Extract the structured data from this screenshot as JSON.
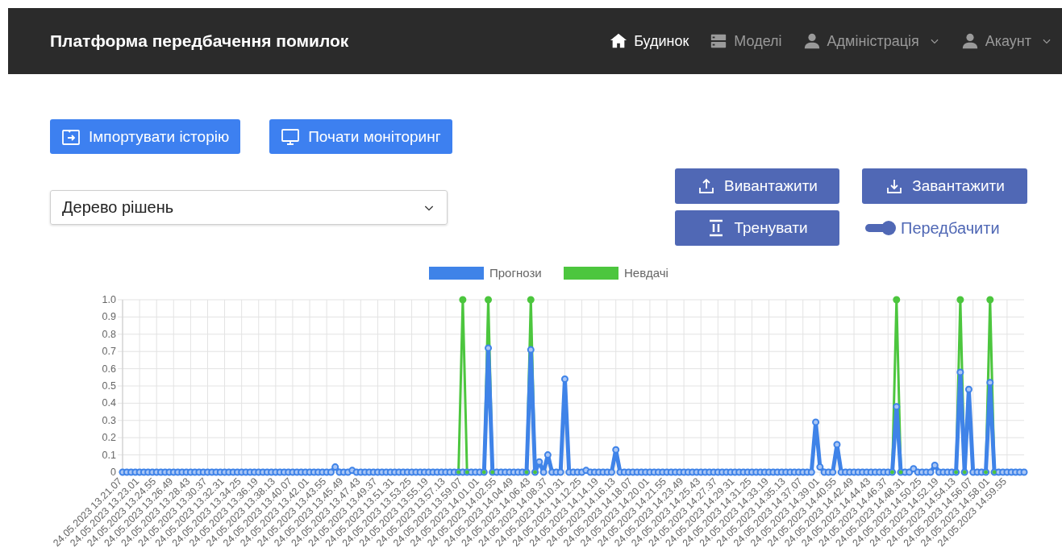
{
  "navbar": {
    "title": "Платформа передбачення помилок",
    "items": [
      {
        "label": "Будинок",
        "selected": true,
        "kind": "link"
      },
      {
        "label": "Моделі",
        "selected": false,
        "kind": "link"
      },
      {
        "label": "Адміністрація",
        "selected": false,
        "kind": "dropdown"
      },
      {
        "label": "Акаунт",
        "selected": false,
        "kind": "dropdown"
      }
    ]
  },
  "actions": [
    {
      "label": "Імпортувати історію"
    },
    {
      "label": "Почати моніторинг"
    }
  ],
  "model_select": {
    "value": "Дерево рішень"
  },
  "model_actions": [
    {
      "label": "Вивантажити"
    },
    {
      "label": "Завантажити"
    },
    {
      "label": "Тренувати"
    }
  ],
  "predict_toggle": {
    "label": "Передбачити",
    "on": true
  },
  "chart": {
    "chart_data": {
      "type": "line",
      "categories": [
        "24.05.2023 13.21.07",
        null,
        null,
        null,
        "24.05.2023 13.23.01",
        null,
        null,
        null,
        "24.05.2023 13.24.55",
        null,
        null,
        null,
        "24.05.2023 13.26.49",
        null,
        null,
        null,
        "24.05.2023 13.28.43",
        null,
        null,
        null,
        "24.05.2023 13.30.37",
        null,
        null,
        null,
        "24.05.2023 13.32.31",
        null,
        null,
        null,
        "24.05.2023 13.34.25",
        null,
        null,
        null,
        "24.05.2023 13.36.19",
        null,
        null,
        null,
        "24.05.2023 13.38.13",
        null,
        null,
        null,
        "24.05.2023 13.40.07",
        null,
        null,
        null,
        "24.05.2023 13.42.01",
        null,
        null,
        null,
        "24.05.2023 13.43.55",
        null,
        null,
        null,
        "24.05.2023 13.45.49",
        null,
        null,
        null,
        "24.05.2023 13.47.43",
        null,
        null,
        null,
        "24.05.2023 13.49.37",
        null,
        null,
        null,
        "24.05.2023 13.51.31",
        null,
        null,
        null,
        "24.05.2023 13.53.25",
        null,
        null,
        null,
        "24.05.2023 13.55.19",
        null,
        null,
        null,
        "24.05.2023 13.57.13",
        null,
        null,
        null,
        "24.05.2023 13.59.07",
        null,
        null,
        null,
        "24.05.2023 14.01.01",
        null,
        null,
        null,
        "24.05.2023 14.02.55",
        null,
        null,
        null,
        "24.05.2023 14.04.49",
        null,
        null,
        null,
        "24.05.2023 14.06.43",
        null,
        null,
        null,
        "24.05.2023 14.08.37",
        null,
        null,
        null,
        "24.05.2023 14.10.31",
        null,
        null,
        null,
        "24.05.2023 14.12.25",
        null,
        null,
        null,
        "24.05.2023 14.14.19",
        null,
        null,
        null,
        "24.05.2023 14.16.13",
        null,
        null,
        null,
        "24.05.2023 14.18.07",
        null,
        null,
        null,
        "24.05.2023 14.20.01",
        null,
        null,
        null,
        "24.05.2023 14.21.55",
        null,
        null,
        null,
        "24.05.2023 14.23.49",
        null,
        null,
        null,
        "24.05.2023 14.25.43",
        null,
        null,
        null,
        "24.05.2023 14.27.37",
        null,
        null,
        null,
        "24.05.2023 14.29.31",
        null,
        null,
        null,
        "24.05.2023 14.31.25",
        null,
        null,
        null,
        "24.05.2023 14.33.19",
        null,
        null,
        null,
        "24.05.2023 14.35.13",
        null,
        null,
        null,
        "24.05.2023 14.37.07",
        null,
        null,
        null,
        "24.05.2023 14.39.01",
        null,
        null,
        null,
        "24.05.2023 14.40.55",
        null,
        null,
        null,
        "24.05.2023 14.42.49",
        null,
        null,
        null,
        "24.05.2023 14.44.43",
        null,
        null,
        null,
        "24.05.2023 14.46.37",
        null,
        null,
        null,
        "24.05.2023 14.48.31",
        null,
        null,
        null,
        "24.05.2023 14.50.25",
        null,
        null,
        null,
        "24.05.2023 14.52.19",
        null,
        null,
        null,
        "24.05.2023 14.54.13",
        null,
        null,
        null,
        "24.05.2023 14.56.07",
        null,
        null,
        null,
        "24.05.2023 14.58.01",
        null,
        null,
        null,
        "24.05.2023 14.59.55",
        null,
        null,
        null,
        null
      ],
      "series": [
        {
          "name": "Прогнози",
          "color": "#3f83e8",
          "marker": "circle",
          "values": [
            0,
            0,
            0,
            0,
            0,
            0,
            0,
            0,
            0,
            0,
            0,
            0,
            0,
            0,
            0,
            0,
            0,
            0,
            0,
            0,
            0,
            0,
            0,
            0,
            0,
            0,
            0,
            0,
            0,
            0,
            0,
            0,
            0,
            0,
            0,
            0,
            0,
            0,
            0,
            0,
            0,
            0,
            0,
            0,
            0,
            0,
            0,
            0,
            0,
            0,
            0.03,
            0,
            0,
            0,
            0.01,
            0,
            0,
            0,
            0,
            0,
            0,
            0,
            0,
            0,
            0,
            0,
            0,
            0,
            0,
            0,
            0,
            0,
            0,
            0,
            0,
            0,
            0,
            0,
            0,
            0,
            0,
            0,
            0,
            0,
            0,
            0,
            0.72,
            0,
            0,
            0,
            0,
            0,
            0,
            0,
            0,
            0,
            0.71,
            0,
            0.06,
            0,
            0.1,
            0,
            0,
            0,
            0.54,
            0,
            0,
            0,
            0,
            0.01,
            0,
            0,
            0,
            0,
            0,
            0,
            0.13,
            0,
            0,
            0,
            0,
            0,
            0,
            0,
            0,
            0,
            0,
            0,
            0,
            0,
            0,
            0,
            0,
            0,
            0,
            0,
            0,
            0,
            0,
            0,
            0,
            0,
            0,
            0,
            0,
            0,
            0,
            0,
            0,
            0,
            0,
            0,
            0,
            0,
            0,
            0,
            0,
            0,
            0,
            0,
            0,
            0,
            0,
            0.29,
            0.03,
            0,
            0,
            0,
            0.16,
            0,
            0,
            0,
            0,
            0,
            0,
            0,
            0,
            0,
            0,
            0,
            0,
            0,
            0.38,
            0,
            0,
            0,
            0.02,
            0,
            0,
            0,
            0,
            0.04,
            0,
            0,
            0,
            0,
            0,
            0.58,
            0,
            0.48,
            0,
            0,
            0,
            0,
            0.52,
            0,
            0,
            0,
            0,
            0,
            0,
            0,
            0
          ]
        },
        {
          "name": "Невдачі",
          "color": "#4cc63e",
          "marker": "circle",
          "values": [
            null,
            null,
            null,
            null,
            null,
            null,
            null,
            null,
            null,
            null,
            null,
            null,
            null,
            null,
            null,
            null,
            null,
            null,
            null,
            null,
            null,
            null,
            null,
            null,
            null,
            null,
            null,
            null,
            null,
            null,
            null,
            null,
            null,
            null,
            null,
            null,
            null,
            null,
            null,
            null,
            null,
            null,
            null,
            null,
            null,
            null,
            null,
            null,
            null,
            null,
            null,
            null,
            null,
            null,
            null,
            null,
            null,
            null,
            null,
            null,
            null,
            null,
            null,
            null,
            null,
            null,
            null,
            null,
            null,
            null,
            null,
            null,
            null,
            null,
            null,
            null,
            null,
            null,
            null,
            0,
            1,
            0,
            null,
            null,
            null,
            0,
            1,
            0,
            null,
            null,
            null,
            null,
            null,
            null,
            null,
            0,
            1,
            0,
            null,
            null,
            null,
            null,
            null,
            null,
            null,
            null,
            null,
            null,
            null,
            null,
            null,
            null,
            null,
            null,
            null,
            null,
            null,
            null,
            null,
            null,
            null,
            null,
            null,
            null,
            null,
            null,
            null,
            null,
            null,
            null,
            null,
            null,
            null,
            null,
            null,
            null,
            null,
            null,
            null,
            null,
            null,
            null,
            null,
            null,
            null,
            null,
            null,
            null,
            null,
            null,
            null,
            null,
            null,
            null,
            null,
            null,
            null,
            null,
            null,
            null,
            null,
            null,
            null,
            null,
            null,
            null,
            null,
            null,
            null,
            null,
            null,
            null,
            null,
            null,
            null,
            null,
            null,
            null,
            null,
            null,
            null,
            0,
            1,
            0,
            null,
            null,
            null,
            null,
            null,
            null,
            null,
            null,
            null,
            null,
            null,
            null,
            0,
            1,
            0,
            null,
            null,
            null,
            null,
            0,
            1,
            0,
            null,
            null,
            null,
            null,
            null,
            null,
            null
          ]
        }
      ],
      "grid": true,
      "legend": "top",
      "ylim": [
        0,
        1
      ],
      "yticks": [
        {
          "value": 0,
          "label": "0"
        },
        {
          "value": 0.1,
          "label": "0.1"
        },
        {
          "value": 0.2,
          "label": "0.2"
        },
        {
          "value": 0.3,
          "label": "0.3"
        },
        {
          "value": 0.4,
          "label": "0.4"
        },
        {
          "value": 0.5,
          "label": "0.5"
        },
        {
          "value": 0.6,
          "label": "0.6"
        },
        {
          "value": 0.7,
          "label": "0.7"
        },
        {
          "value": 0.8,
          "label": "0.8"
        },
        {
          "value": 0.9,
          "label": "0.9"
        },
        {
          "value": 1,
          "label": "1.0"
        }
      ]
    }
  }
}
